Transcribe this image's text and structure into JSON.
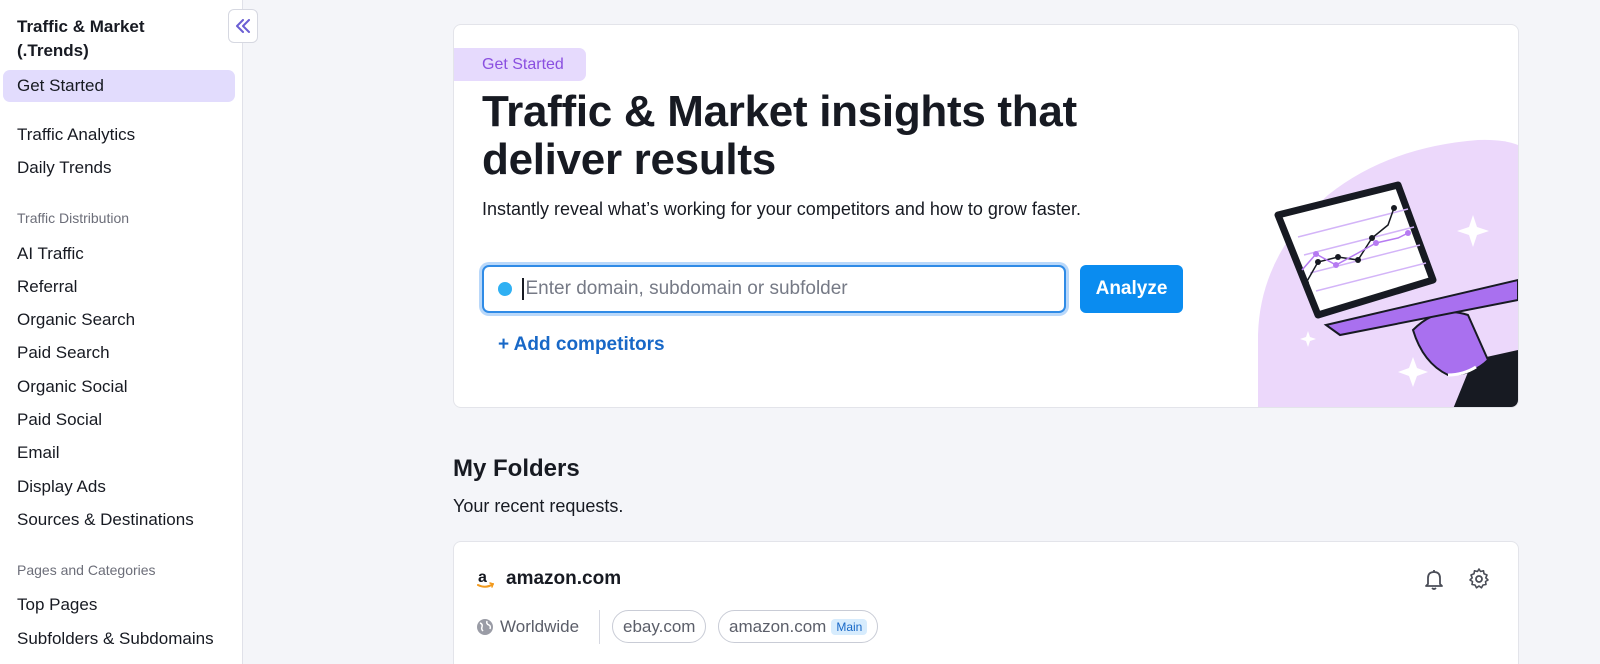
{
  "sidebar": {
    "title": "Traffic & Market (.Trends)",
    "items_top": [
      {
        "label": "Get Started",
        "active": true
      },
      {
        "label": "Traffic Analytics"
      },
      {
        "label": "Daily Trends"
      }
    ],
    "section_distribution": "Traffic Distribution",
    "items_distribution": [
      {
        "label": "AI Traffic"
      },
      {
        "label": "Referral"
      },
      {
        "label": "Organic Search"
      },
      {
        "label": "Paid Search"
      },
      {
        "label": "Organic Social"
      },
      {
        "label": "Paid Social"
      },
      {
        "label": "Email"
      },
      {
        "label": "Display Ads"
      },
      {
        "label": "Sources & Destinations"
      }
    ],
    "section_pages": "Pages and Categories",
    "items_pages": [
      {
        "label": "Top Pages"
      },
      {
        "label": "Subfolders & Subdomains"
      }
    ]
  },
  "hero": {
    "tag": "Get Started",
    "title": "Traffic & Market insights that deliver results",
    "subtitle": "Instantly reveal what’s working for your competitors and how to grow faster.",
    "search_placeholder": "Enter domain, subdomain or subfolder",
    "search_value": "",
    "analyze_label": "Analyze",
    "add_competitors_label": "+ Add competitors"
  },
  "folders": {
    "title": "My Folders",
    "subtitle": "Your recent requests.",
    "cards": [
      {
        "name": "amazon.com",
        "region": "Worldwide",
        "chips": [
          {
            "label": "ebay.com",
            "badge": ""
          },
          {
            "label": "amazon.com",
            "badge": "Main"
          }
        ]
      }
    ]
  },
  "colors": {
    "accent_blue": "#0a8cf0",
    "link_blue": "#1868c7",
    "active_purple_bg": "#e2dcfd",
    "tag_purple": "#8a4fe0"
  },
  "icons": [
    "collapse-double-chevron-left-icon",
    "search-dot-icon",
    "amazon-logo-icon",
    "bell-icon",
    "gear-icon",
    "globe-icon"
  ]
}
